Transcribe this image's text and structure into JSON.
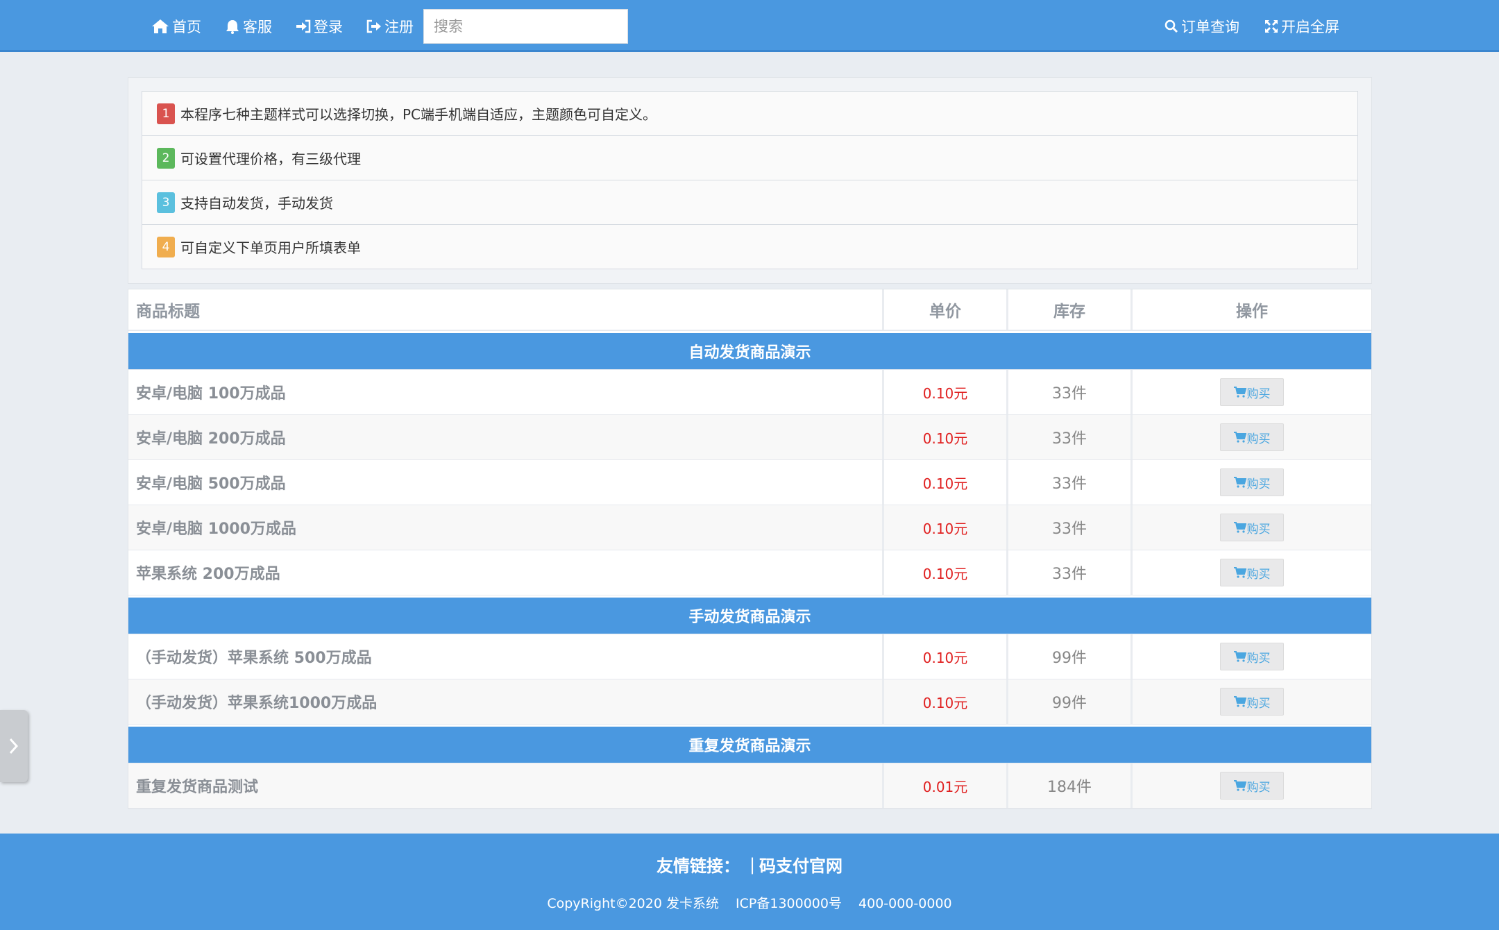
{
  "nav": {
    "home": "首页",
    "service": "客服",
    "login": "登录",
    "register": "注册",
    "search_placeholder": "搜索",
    "order_query": "订单查询",
    "fullscreen": "开启全屏",
    "icons": [
      "home-icon",
      "bell-icon",
      "sign-in-icon",
      "sign-out-icon",
      "search-icon",
      "expand-icon"
    ]
  },
  "notices": [
    {
      "num": "1",
      "color": "#d9534f",
      "text": "本程序七种主题样式可以选择切换，PC端手机端自适应，主题颜色可自定义。"
    },
    {
      "num": "2",
      "color": "#5cb85c",
      "text": "可设置代理价格，有三级代理"
    },
    {
      "num": "3",
      "color": "#5bc0de",
      "text": "支持自动发货，手动发货"
    },
    {
      "num": "4",
      "color": "#f0ad4e",
      "text": "可自定义下单页用户所填表单"
    }
  ],
  "table": {
    "headers": {
      "title": "商品标题",
      "price": "单价",
      "stock": "库存",
      "op": "操作"
    },
    "buy_label": "购买",
    "groups": [
      {
        "name": "自动发货商品演示",
        "items": [
          {
            "title": "安卓/电脑 100万成品",
            "price": "0.10元",
            "stock": "33件"
          },
          {
            "title": "安卓/电脑 200万成品",
            "price": "0.10元",
            "stock": "33件"
          },
          {
            "title": "安卓/电脑 500万成品",
            "price": "0.10元",
            "stock": "33件"
          },
          {
            "title": "安卓/电脑 1000万成品",
            "price": "0.10元",
            "stock": "33件"
          },
          {
            "title": "苹果系统 200万成品",
            "price": "0.10元",
            "stock": "33件"
          }
        ]
      },
      {
        "name": "手动发货商品演示",
        "items": [
          {
            "title": "（手动发货）苹果系统 500万成品",
            "price": "0.10元",
            "stock": "99件"
          },
          {
            "title": "（手动发货）苹果系统1000万成品",
            "price": "0.10元",
            "stock": "99件"
          }
        ]
      },
      {
        "name": "重复发货商品演示",
        "items": [
          {
            "title": "重复发货商品测试",
            "price": "0.01元",
            "stock": "184件"
          }
        ]
      }
    ]
  },
  "footer": {
    "links_label": "友情链接：",
    "separator": "|",
    "link": "码支付官网",
    "copyright": "CopyRight©2020 发卡系统",
    "icp": "ICP备1300000号",
    "phone": "400-000-0000"
  },
  "colors": {
    "accent": "#4a98e0",
    "price": "#e02020"
  }
}
